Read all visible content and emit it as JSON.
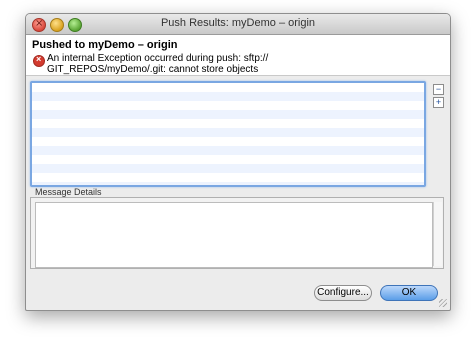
{
  "window": {
    "title": "Push Results: myDemo – origin"
  },
  "header": {
    "title": "Pushed to myDemo – origin",
    "message_line1": "An internal Exception occurred during push: sftp://",
    "message_line2": "GIT_REPOS/myDemo/.git: cannot store objects",
    "error_icon": "error-icon"
  },
  "side_buttons": {
    "collapse": "−",
    "expand": "+"
  },
  "details": {
    "label": "Message Details"
  },
  "buttons": {
    "configure": "Configure...",
    "ok": "OK"
  },
  "colors": {
    "accent": "#7aa7e2",
    "row_alt": "#edf3fe",
    "error": "#d33b2f",
    "ok_button": "#5a9ee8"
  }
}
